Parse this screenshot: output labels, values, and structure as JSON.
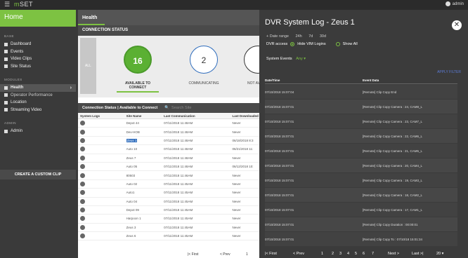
{
  "topbar": {
    "menu_icon": "hamburger-icon",
    "brand_prefix": "m",
    "brand_suffix": "SET",
    "user": "admin"
  },
  "sidebar": {
    "home": "Home",
    "sections": [
      {
        "label": "BASE",
        "items": [
          {
            "label": "Dashboard",
            "icon": "dashboard-icon"
          },
          {
            "label": "Events",
            "icon": "bookmark-icon"
          },
          {
            "label": "Video Clips",
            "icon": "video-icon"
          },
          {
            "label": "Site Status",
            "icon": "list-icon"
          }
        ]
      },
      {
        "label": "MODULES",
        "items": [
          {
            "label": "Health",
            "icon": "health-icon",
            "active": true
          },
          {
            "label": "Operator Performance",
            "icon": "report-icon"
          },
          {
            "label": "Location",
            "icon": "map-icon"
          },
          {
            "label": "Streaming Video",
            "icon": "camera-icon"
          }
        ]
      },
      {
        "label": "ADMIN",
        "items": [
          {
            "label": "Admin",
            "icon": "gear-icon"
          }
        ]
      }
    ],
    "create_clip": "CREATE A CUSTOM CLIP"
  },
  "main": {
    "header": "Health",
    "connection_status": "CONNECTION STATUS",
    "all_label": "ALL",
    "circles": [
      {
        "value": "16",
        "label": "AVAILABLE TO CONNECT"
      },
      {
        "value": "2",
        "label": "COMMUNICATING"
      },
      {
        "value": "",
        "label": "NOT AV"
      }
    ],
    "table_title": "Connection Status | Available to Connect",
    "search_placeholder": "Search Site",
    "columns": [
      "System Logs",
      "Site Name",
      "Last Communication",
      "Last Downloaded"
    ],
    "rows": [
      {
        "site": "Depot 44",
        "comm": "07/11/2018 11:48AM",
        "down": "Never"
      },
      {
        "site": "Dev-HOB",
        "comm": "07/11/2018 11:48AM",
        "down": "Never"
      },
      {
        "site": "Zeus 1",
        "comm": "07/11/2018 11:48AM",
        "down": "06/18/2018 8:3",
        "hl": true
      },
      {
        "site": "Auto 10",
        "comm": "07/11/2018 11:48AM",
        "down": "06/21/2018 11:"
      },
      {
        "site": "Zeus 7",
        "comm": "07/11/2018 11:48AM",
        "down": "Never"
      },
      {
        "site": "Auto 05",
        "comm": "07/11/2018 11:48AM",
        "down": "06/12/2018 10:"
      },
      {
        "site": "80503",
        "comm": "07/11/2018 11:46AM",
        "down": "Never"
      },
      {
        "site": "Auto 02",
        "comm": "07/11/2018 11:45AM",
        "down": "Never"
      },
      {
        "site": "Auto1",
        "comm": "07/11/2018 11:45AM",
        "down": "Never"
      },
      {
        "site": "Auto 04",
        "comm": "07/11/2018 11:45AM",
        "down": "Never"
      },
      {
        "site": "Depot 09",
        "comm": "07/11/2018 11:45AM",
        "down": "Never"
      },
      {
        "site": "Harpoon 1",
        "comm": "07/11/2018 11:45AM",
        "down": "Never"
      },
      {
        "site": "Zeus 3",
        "comm": "07/11/2018 11:45AM",
        "down": "Never"
      },
      {
        "site": "Zeus 6",
        "comm": "07/11/2018 11:45AM",
        "down": "Never"
      }
    ],
    "pager": {
      "first": "|< First",
      "prev": "< Prev",
      "page": "1"
    }
  },
  "overlay": {
    "title": "DVR System Log - Zeus 1",
    "date_range": "+ Date range",
    "ranges": [
      "24h",
      "7d",
      "30d"
    ],
    "dvr_access": "DVR access",
    "hide_vim": "Hide VIM Logins",
    "show_all": "Show All",
    "system_events": "System Events",
    "any": "Any",
    "apply": "APPLY FILTER",
    "col_date": "Date/Time",
    "col_event": "Event Data",
    "rows": [
      {
        "date": "07/10/2018 15:07:04",
        "event": "[Remote] Clip Copy End"
      },
      {
        "date": "07/10/2018 15:07:01",
        "event": "[Remote] Clip Copy Camera : 24, CAM8_L"
      },
      {
        "date": "07/10/2018 15:07:01",
        "event": "[Remote] Clip Copy Camera : 23, CAM7_L"
      },
      {
        "date": "07/10/2018 15:07:01",
        "event": "[Remote] Clip Copy Camera : 22, CAM6_L"
      },
      {
        "date": "07/10/2018 15:07:01",
        "event": "[Remote] Clip Copy Camera : 21, CAM5_L"
      },
      {
        "date": "07/10/2018 15:07:01",
        "event": "[Remote] Clip Copy Camera : 20, CAM4_L"
      },
      {
        "date": "07/10/2018 15:07:01",
        "event": "[Remote] Clip Copy Camera : 19, CAM3_L"
      },
      {
        "date": "07/10/2018 15:07:01",
        "event": "[Remote] Clip Copy Camera : 18, CAM2_L"
      },
      {
        "date": "07/10/2018 15:07:01",
        "event": "[Remote] Clip Copy Camera : 17, CAM1_L"
      },
      {
        "date": "07/10/2018 15:07:01",
        "event": "[Remote] Clip Copy Duration : 00:00:01"
      },
      {
        "date": "07/10/2018 15:07:01",
        "event": "[Remote] Clip Copy To : 07/10/18 15:01:34"
      }
    ],
    "pager": {
      "first": "|< First",
      "prev": "< Prev",
      "pages": [
        "1",
        "2",
        "3",
        "4",
        "5",
        "6",
        "7"
      ],
      "next": "Next >",
      "last": "Last >|",
      "per_page": "20"
    }
  },
  "colors": {
    "accent": "#7dc242",
    "blue": "#2f6dbd"
  }
}
